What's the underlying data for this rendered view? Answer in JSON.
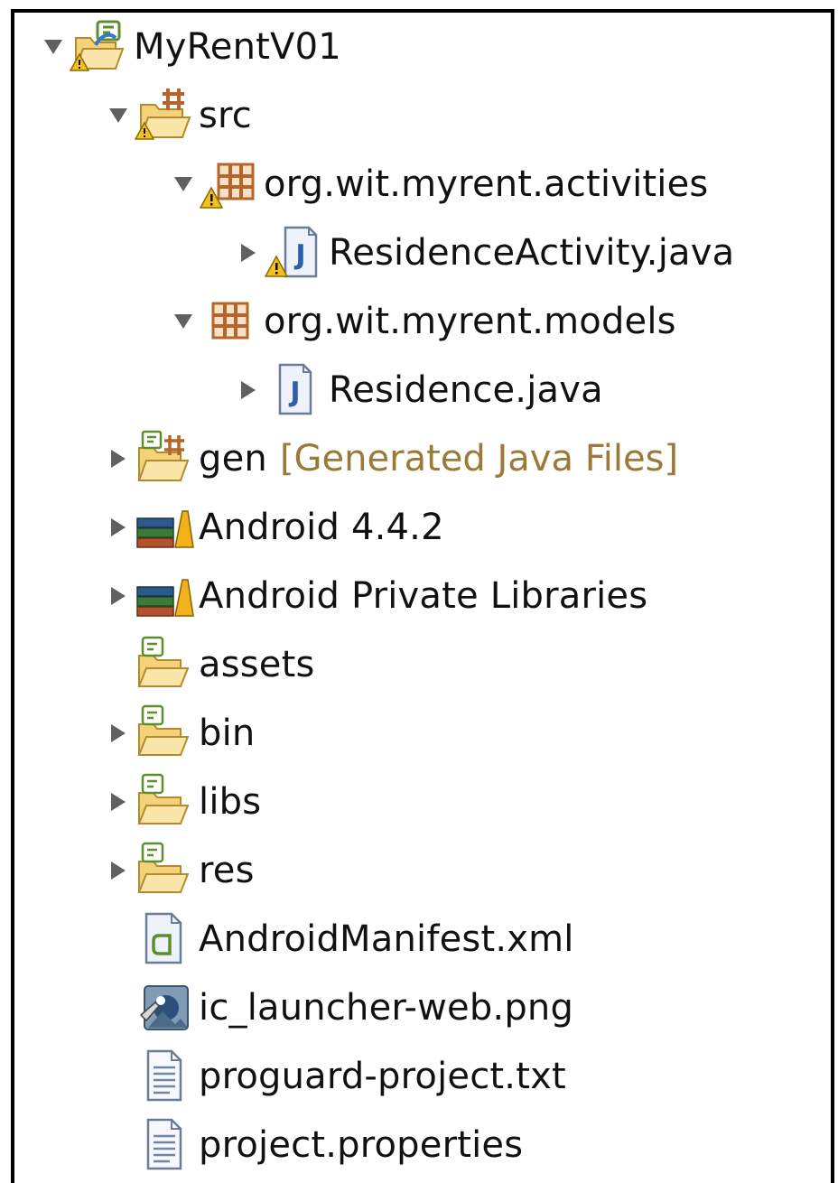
{
  "tree": {
    "project": {
      "label": "MyRentV01",
      "expanded": true,
      "icon": "android-project-warning-icon"
    },
    "src": {
      "label": "src",
      "expanded": true,
      "icon": "source-folder-warning-icon"
    },
    "pkg_activities": {
      "label": "org.wit.myrent.activities",
      "expanded": true,
      "icon": "package-warning-icon"
    },
    "file_residence_activity": {
      "label": "ResidenceActivity.java",
      "expanded": false,
      "icon": "java-file-warning-icon"
    },
    "pkg_models": {
      "label": "org.wit.myrent.models",
      "expanded": true,
      "icon": "package-icon"
    },
    "file_residence": {
      "label": "Residence.java",
      "expanded": false,
      "icon": "java-file-icon"
    },
    "gen": {
      "label": "gen",
      "decoration": "[Generated Java Files]",
      "expanded": false,
      "icon": "generated-source-folder-icon"
    },
    "android_lib": {
      "label": "Android 4.4.2",
      "expanded": false,
      "icon": "library-icon"
    },
    "private_libs": {
      "label": "Android Private Libraries",
      "expanded": false,
      "icon": "library-icon"
    },
    "assets": {
      "label": "assets",
      "icon": "folder-icon"
    },
    "bin": {
      "label": "bin",
      "expanded": false,
      "icon": "folder-icon"
    },
    "libs": {
      "label": "libs",
      "expanded": false,
      "icon": "folder-icon"
    },
    "res": {
      "label": "res",
      "expanded": false,
      "icon": "folder-icon"
    },
    "manifest": {
      "label": "AndroidManifest.xml",
      "icon": "android-manifest-icon"
    },
    "launcher_png": {
      "label": "ic_launcher-web.png",
      "icon": "image-file-icon"
    },
    "proguard": {
      "label": "proguard-project.txt",
      "icon": "text-file-icon"
    },
    "properties": {
      "label": "project.properties",
      "icon": "text-file-icon"
    }
  },
  "colors": {
    "folder": "#f3d27a",
    "folder_stroke": "#b48a2c",
    "package": "#b5652a",
    "java_blue": "#2f5fa8",
    "warning": "#f2c21b",
    "decoration_text": "#9a7a36",
    "android_green": "#8fbf3a"
  }
}
